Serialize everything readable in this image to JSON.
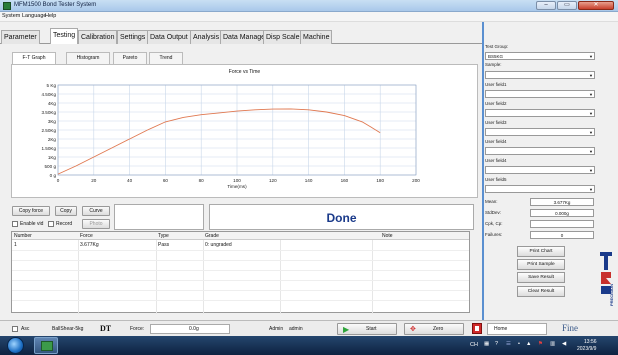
{
  "window": {
    "title": "MFM1500 Bond Tester System",
    "min": "–",
    "max": "▭",
    "close": "✕"
  },
  "menu": [
    "System",
    "Language",
    "Help"
  ],
  "tabs": [
    "Parameter",
    "Testing",
    "Calibration",
    "Settings",
    "Data Output",
    "Analysis",
    "Data Manage",
    "Disp Scale",
    "Machine"
  ],
  "active_tab": "Testing",
  "subtabs": [
    "F-T Graph",
    "Histogram",
    "Pareto",
    "Trend"
  ],
  "active_subtab": "F-T Graph",
  "chart_data": {
    "type": "line",
    "title": "Force vs Time",
    "xlabel": "Time(ms)",
    "ylabel": "",
    "x_ticks": [
      0,
      20,
      40,
      60,
      80,
      100,
      120,
      140,
      160,
      180,
      200
    ],
    "y_ticks": [
      "0 g",
      "500 g",
      "1Kg",
      "1.50Kg",
      "2Kg",
      "2.50Kg",
      "3Kg",
      "3.50Kg",
      "4Kg",
      "4.50Kg",
      "5 Kg"
    ],
    "xlim": [
      0,
      200
    ],
    "ylim": [
      0,
      5
    ],
    "grid": true,
    "series": [
      {
        "color": "#e07850",
        "x": [
          0,
          10,
          20,
          30,
          40,
          50,
          60,
          70,
          80,
          90,
          100,
          110,
          120,
          130,
          140,
          150,
          160,
          170,
          175,
          180
        ],
        "y": [
          0.05,
          0.5,
          1.0,
          1.5,
          2.0,
          2.5,
          2.95,
          3.2,
          3.35,
          3.45,
          3.55,
          3.62,
          3.66,
          3.67,
          3.62,
          3.5,
          3.3,
          2.95,
          2.65,
          2.35
        ]
      }
    ]
  },
  "controls": {
    "copy_force": "Copy force",
    "copy": "Copy",
    "curve": "Curve",
    "photo": "Photo",
    "enable_vid": "Enable vid",
    "record": "Record"
  },
  "status_text": "Done",
  "table": {
    "headers": [
      "Number",
      "Force",
      "Type",
      "Grade",
      "Note"
    ],
    "rows": [
      [
        "1",
        "3.677Kg",
        "Pass",
        "0: ungraded",
        ""
      ]
    ]
  },
  "right_panel": {
    "test_group_label": "Test Group:",
    "test_group_value": "BS5KG",
    "sample_label": "Sample:",
    "user_fields": [
      "User field1",
      "User field2",
      "User field3",
      "User field4",
      "User field4",
      "User field5"
    ],
    "mean_label": "Mean:",
    "mean_value": "3.677Kg",
    "stddev_label": "StdDev:",
    "stddev_value": "0.000g",
    "cpk_label": "Cpk, Cp:",
    "cpk_value": "",
    "failures_label": "Failures:",
    "failures_value": "0",
    "buttons": [
      "Print Chart",
      "Print Sample",
      "Save Result",
      "Clear Result"
    ],
    "logo_text": "PRECISION"
  },
  "bottom_bar": {
    "asc_label": "Asc",
    "load_cell": "BallShear-5kg",
    "dt": "DT",
    "force_label": "Force:",
    "force_value": "0.0g",
    "user_role": "Admin",
    "user_name": "admin",
    "start": "Start",
    "zero": "Zero",
    "home": "Home",
    "fine": "Fine"
  },
  "taskbar": {
    "lang": "CH",
    "time": "13:56",
    "date": "2023/9/9"
  },
  "colors": {
    "accent": "#5a8fd0",
    "curve": "#e07850",
    "done": "#1a3a8a"
  }
}
